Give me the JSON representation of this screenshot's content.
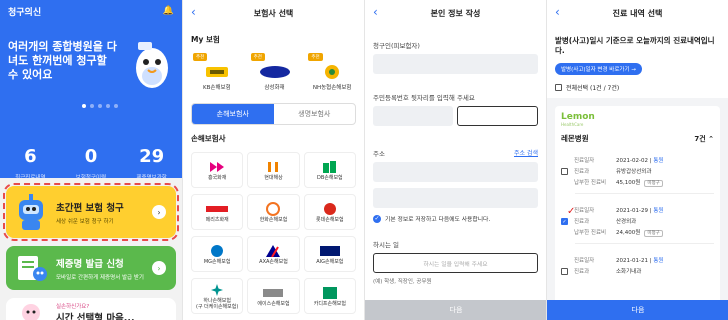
{
  "screen1": {
    "app_logo": "청구의신",
    "banner_text": "여러개의 종합병원을 다녀도 한꺼번에 청구할 수 있어요",
    "stats": [
      {
        "value": "6",
        "label": "최근진료내역"
      },
      {
        "value": "0",
        "label": "보험청구이력"
      },
      {
        "value": "29",
        "label": "제증명보관함"
      }
    ],
    "cards": [
      {
        "title": "초간편 보험 청구",
        "subtitle": "세상 쉬운 보험 청구 하기"
      },
      {
        "title": "제증명 발급 신청",
        "subtitle": "모바일로 간편하게 제증명서 발급 받기"
      },
      {
        "title": "시간 선택형 마음...",
        "subtitle": "실손하신가요?"
      }
    ]
  },
  "screen2": {
    "title": "보험사 선택",
    "my_section": "My 보험",
    "my_tag": "추천",
    "my_insurers": [
      "KB손해보험",
      "삼성화재",
      "NH농협손해보험"
    ],
    "tabs": [
      "손해보험사",
      "생명보험사"
    ],
    "list_section": "손해보험사",
    "insurers": [
      "흥국화재",
      "현대해상",
      "DB손해보험",
      "메리츠화재",
      "한화손해보험",
      "롯데손해보험",
      "MG손해보험",
      "AXA손해보험",
      "AIG손해보험",
      "하나손해보험\n(구 더케이손해보험)",
      "에이스손해보험",
      "카디프손해보험"
    ]
  },
  "screen3": {
    "title": "본인 정보 작성",
    "claimant_label": "청구인(피보험자)",
    "ssn_label": "주민등록번호 뒷자리를 입력해 주세요",
    "address_label": "주소",
    "address_search": "주소 검색",
    "save_check": "기본 정보로 저장하고 다음에도 사용합니다.",
    "job_label": "하시는 일",
    "job_placeholder": "하시는 일을 입력해 주세요",
    "job_hint": "(예) 학생, 직장인, 공무원",
    "next_button": "다음"
  },
  "screen4": {
    "title": "진료 내역 선택",
    "notice": "발병(사고)일시 기준으로 오늘까지의 진료내역입니다.",
    "chip": "발병(사고)일자 변경 바로가기 →",
    "select_all": "전체선택 (1건 / 7건)",
    "hospital_logo": "Lemon",
    "hospital_logo_sub": "HealthCare",
    "hospital_name": "레몬병원",
    "hospital_count": "7건",
    "records": [
      {
        "date": "2021-02-02",
        "detail_link": "통원",
        "dept": "유방갑상선외과",
        "amount": "45,100원",
        "paid": "미청구",
        "checked": false
      },
      {
        "date": "2021-01-29",
        "detail_link": "통원",
        "dept": "산경외과",
        "amount": "24,400원",
        "paid": "미청구",
        "checked": true
      },
      {
        "date": "2021-01-21",
        "detail_link": "통원",
        "dept": "소화기내과",
        "amount": "",
        "paid": "",
        "checked": false
      }
    ],
    "record_labels": {
      "date": "진료일자",
      "dept": "진료과",
      "amount": "납부한 진료비"
    },
    "next_button": "다음"
  }
}
